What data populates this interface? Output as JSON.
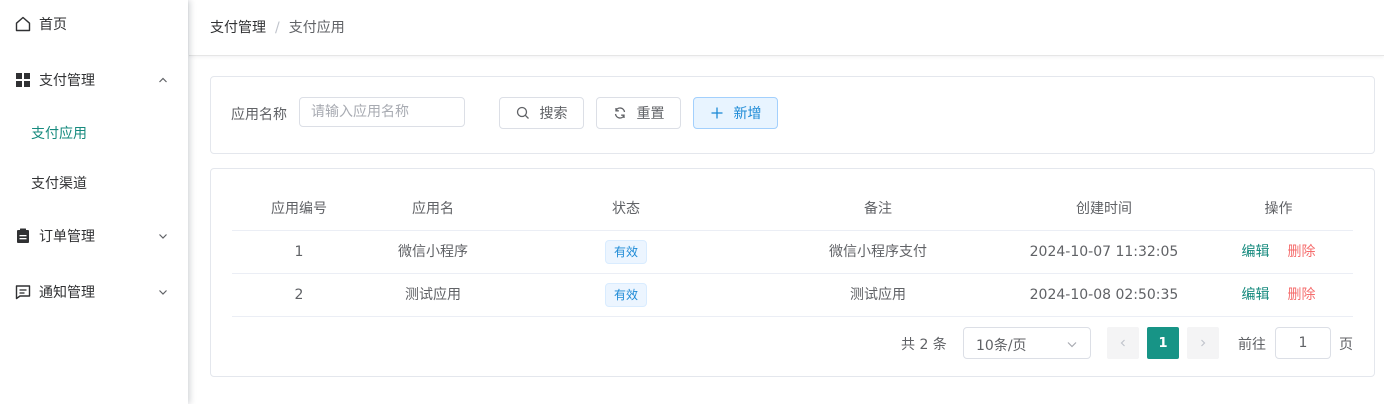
{
  "sidebar": {
    "home": "首页",
    "pay_management": "支付管理",
    "pay_app": "支付应用",
    "pay_channel": "支付渠道",
    "order_management": "订单管理",
    "notify_management": "通知管理"
  },
  "breadcrumb": {
    "root": "支付管理",
    "separator": "/",
    "current": "支付应用"
  },
  "search": {
    "label": "应用名称",
    "placeholder": "请输入应用名称",
    "search_button": "搜索",
    "reset_button": "重置",
    "add_button": "新增"
  },
  "table": {
    "headers": [
      "应用编号",
      "应用名",
      "状态",
      "备注",
      "创建时间",
      "操作"
    ],
    "rows": [
      {
        "id": "1",
        "name": "微信小程序",
        "status": "有效",
        "remark": "微信小程序支付",
        "created": "2024-10-07 11:32:05",
        "edit": "编辑",
        "delete": "删除"
      },
      {
        "id": "2",
        "name": "测试应用",
        "status": "有效",
        "remark": "测试应用",
        "created": "2024-10-08 02:50:35",
        "edit": "编辑",
        "delete": "删除"
      }
    ]
  },
  "pagination": {
    "total": "共 2 条",
    "page_size": "10条/页",
    "current_page": "1",
    "goto_label": "前往",
    "goto_value": "1",
    "goto_suffix": "页"
  },
  "colors": {
    "accent": "#179486",
    "active_menu": "#168a7e",
    "delete": "#f56c6c",
    "tag": "#1d8ad6"
  }
}
